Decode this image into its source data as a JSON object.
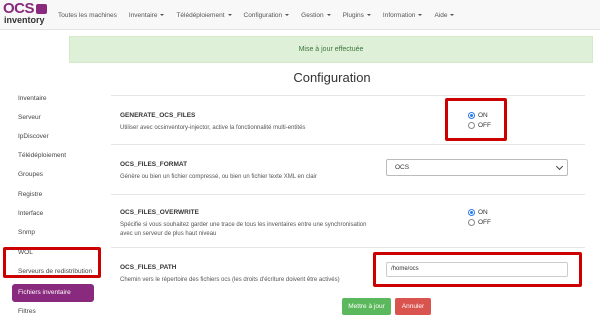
{
  "logo": {
    "line1": "OCS",
    "line2": "inventory"
  },
  "nav": [
    {
      "label": "Toutes les machines",
      "dropdown": false
    },
    {
      "label": "Inventaire",
      "dropdown": true
    },
    {
      "label": "Télédéploiement",
      "dropdown": true
    },
    {
      "label": "Configuration",
      "dropdown": true
    },
    {
      "label": "Gestion",
      "dropdown": true
    },
    {
      "label": "Plugins",
      "dropdown": true
    },
    {
      "label": "Information",
      "dropdown": true
    },
    {
      "label": "Aide",
      "dropdown": true
    }
  ],
  "sidebar": {
    "items": [
      "Inventaire",
      "Serveur",
      "IpDiscover",
      "Télédéploiement",
      "Groupes",
      "Registre",
      "Interface",
      "Snmp",
      "WOL",
      "Serveurs de redistribution",
      "Fichiers inventaire",
      "Filtres"
    ],
    "active": "Fichiers inventaire"
  },
  "alert": "Mise à jour effectuée",
  "title": "Configuration",
  "options": {
    "generate": {
      "name": "GENERATE_OCS_FILES",
      "desc": "Utiliser avec ocsinventory-injector, active la fonctionnalité multi-entités",
      "on": "ON",
      "off": "OFF",
      "value": "ON"
    },
    "format": {
      "name": "OCS_FILES_FORMAT",
      "desc": "Génère ou bien un fichier compressé, ou bien un fichier texte XML en clair",
      "value": "OCS"
    },
    "overwrite": {
      "name": "OCS_FILES_OVERWRITE",
      "desc1": "Spécifie si vous souhaitez garder une trace de tous les inventaires entre une synchronisation",
      "desc2": "avec un serveur de plus haut niveau",
      "on": "ON",
      "off": "OFF",
      "value": "ON"
    },
    "path": {
      "name": "OCS_FILES_PATH",
      "desc": "Chemin vers le répertoire des fichiers ocs (les droits d'écriture doivent être activés)",
      "value": "/home/ocs"
    }
  },
  "buttons": {
    "save": "Mettre à jour",
    "cancel": "Annuler"
  },
  "colors": {
    "brand": "#8a2a7e",
    "highlight": "#cc0000",
    "success": "#5cb85c",
    "danger": "#d9534f"
  }
}
